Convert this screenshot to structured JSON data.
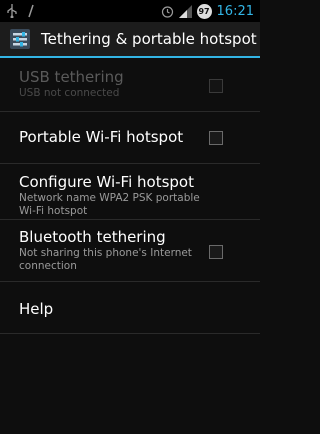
{
  "status_bar": {
    "left_icons": [
      "usb-icon",
      "debug-icon"
    ],
    "right_icons": [
      "alarm-icon",
      "signal-icon"
    ],
    "battery_level": "97",
    "time": "16:21"
  },
  "action_bar": {
    "title": "Tethering & portable hotspot",
    "icon": "tethering-settings-icon",
    "accent_color": "#33b5e5"
  },
  "preferences": [
    {
      "title": "USB tethering",
      "summary": "USB not connected",
      "checked": false,
      "enabled": false
    },
    {
      "title": "Portable Wi-Fi hotspot",
      "checked": false,
      "enabled": true
    },
    {
      "title": "Configure Wi-Fi hotspot",
      "summary": "Network name WPA2 PSK portable Wi-Fi hotspot",
      "enabled": true
    },
    {
      "title": "Bluetooth tethering",
      "summary": "Not sharing this phone's Internet connection",
      "checked": false,
      "enabled": true
    },
    {
      "title": "Help",
      "enabled": true
    }
  ]
}
